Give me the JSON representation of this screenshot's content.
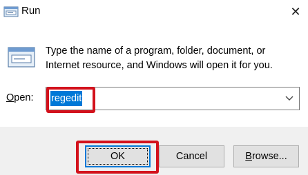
{
  "window": {
    "title": "Run",
    "close_glyph": "✕"
  },
  "dialog": {
    "description": "Type the name of a program, folder, document, or Internet resource, and Windows will open it for you.",
    "open_label_mnemonic": "O",
    "open_label_rest": "pen:",
    "open_value": "regedit"
  },
  "buttons": {
    "ok_label": "OK",
    "cancel_label": "Cancel",
    "browse_mnemonic": "B",
    "browse_rest": "rowse..."
  },
  "icons": {
    "title": "run-icon",
    "dialog": "run-icon",
    "dropdown": "chevron-down-icon",
    "close": "close-icon"
  },
  "colors": {
    "highlight": "#d3121c",
    "selection": "#0078d7",
    "footer_bg": "#f0f0f0"
  }
}
